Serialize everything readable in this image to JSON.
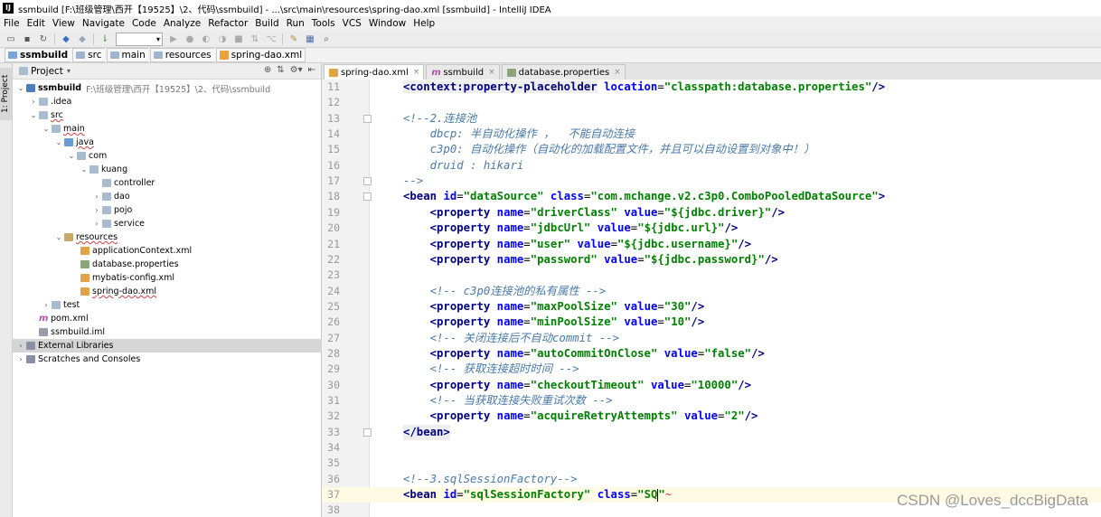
{
  "window": {
    "title": "ssmbuild [F:\\班级管理\\西开【19525】\\2、代码\\ssmbuild] - ...\\src\\main\\resources\\spring-dao.xml [ssmbuild] - IntelliJ IDEA",
    "app_icon": "IJ"
  },
  "menu": [
    "File",
    "Edit",
    "View",
    "Navigate",
    "Code",
    "Analyze",
    "Refactor",
    "Build",
    "Run",
    "Tools",
    "VCS",
    "Window",
    "Help"
  ],
  "breadcrumbs": [
    "ssmbuild",
    "src",
    "main",
    "resources",
    "spring-dao.xml"
  ],
  "side_tab": "1: Project",
  "project_panel": {
    "title": "Project",
    "tree": [
      {
        "label": "ssmbuild",
        "extra": "F:\\班级管理\\西开【19525】\\2、代码\\ssmbuild"
      },
      {
        "label": ".idea"
      },
      {
        "label": "src"
      },
      {
        "label": "main"
      },
      {
        "label": "java"
      },
      {
        "label": "com"
      },
      {
        "label": "kuang"
      },
      {
        "label": "controller"
      },
      {
        "label": "dao"
      },
      {
        "label": "pojo"
      },
      {
        "label": "service"
      },
      {
        "label": "resources"
      },
      {
        "label": "applicationContext.xml"
      },
      {
        "label": "database.properties"
      },
      {
        "label": "mybatis-config.xml"
      },
      {
        "label": "spring-dao.xml"
      },
      {
        "label": "test"
      },
      {
        "label": "pom.xml"
      },
      {
        "label": "ssmbuild.iml"
      },
      {
        "label": "External Libraries"
      },
      {
        "label": "Scratches and Consoles"
      }
    ]
  },
  "editor_tabs": [
    {
      "label": "spring-dao.xml",
      "active": true
    },
    {
      "label": "ssmbuild",
      "active": false
    },
    {
      "label": "database.properties",
      "active": false
    }
  ],
  "lines": {
    "n11": "11",
    "n12": "12",
    "n13": "13",
    "n14": "14",
    "n15": "15",
    "n16": "16",
    "n17": "17",
    "n18": "18",
    "n19": "19",
    "n20": "20",
    "n21": "21",
    "n22": "22",
    "n23": "23",
    "n24": "24",
    "n25": "25",
    "n26": "26",
    "n27": "27",
    "n28": "28",
    "n29": "29",
    "n30": "30",
    "n31": "31",
    "n32": "32",
    "n33": "33",
    "n34": "34",
    "n35": "35",
    "n36": "36",
    "n37": "37",
    "n38": "38"
  },
  "code": {
    "l11_tag": "<context:property-placeholder",
    "l11_attr": "location",
    "l11_val": "\"classpath:database.properties\"",
    "l11_end": "/>",
    "l13": "<!--2.连接池",
    "l14": "    dbcp: 半自动化操作 ，  不能自动连接",
    "l15": "    c3p0: 自动化操作（自动化的加载配置文件，并且可以自动设置到对象中！）",
    "l16": "    druid : hikari",
    "l17": "-->",
    "l18_tag": "<bean",
    "l18_a1": "id",
    "l18_v1": "\"dataSource\"",
    "l18_a2": "class",
    "l18_v2": "\"com.mchange.v2.c3p0.ComboPooledDataSource\"",
    "l18_end": ">",
    "p_tag": "<property",
    "p_name": "name",
    "p_value": "value",
    "p_end": "/>",
    "l19_n": "\"driverClass\"",
    "l19_v": "\"${jdbc.driver}\"",
    "l20_n": "\"jdbcUrl\"",
    "l20_v": "\"${jdbc.url}\"",
    "l21_n": "\"user\"",
    "l21_v": "\"${jdbc.username}\"",
    "l22_n": "\"password\"",
    "l22_v": "\"${jdbc.password}\"",
    "l24": "<!-- c3p0连接池的私有属性 -->",
    "l25_n": "\"maxPoolSize\"",
    "l25_v": "\"30\"",
    "l26_n": "\"minPoolSize\"",
    "l26_v": "\"10\"",
    "l27": "<!-- 关闭连接后不自动commit -->",
    "l28_n": "\"autoCommitOnClose\"",
    "l28_v": "\"false\"",
    "l29": "<!-- 获取连接超时时间 -->",
    "l30_n": "\"checkoutTimeout\"",
    "l30_v": "\"10000\"",
    "l31": "<!-- 当获取连接失败重试次数 -->",
    "l32_n": "\"acquireRetryAttempts\"",
    "l32_v": "\"2\"",
    "l33": "</bean>",
    "l36": "<!--3.sqlSessionFactory-->",
    "l37_tag": "<bean",
    "l37_a1": "id",
    "l37_v1": "\"sqlSessionFactory\"",
    "l37_a2": "class",
    "l37_v2a": "\"SQ",
    "l37_v2b": "\""
  },
  "watermark": "CSDN @Loves_dccBigData"
}
